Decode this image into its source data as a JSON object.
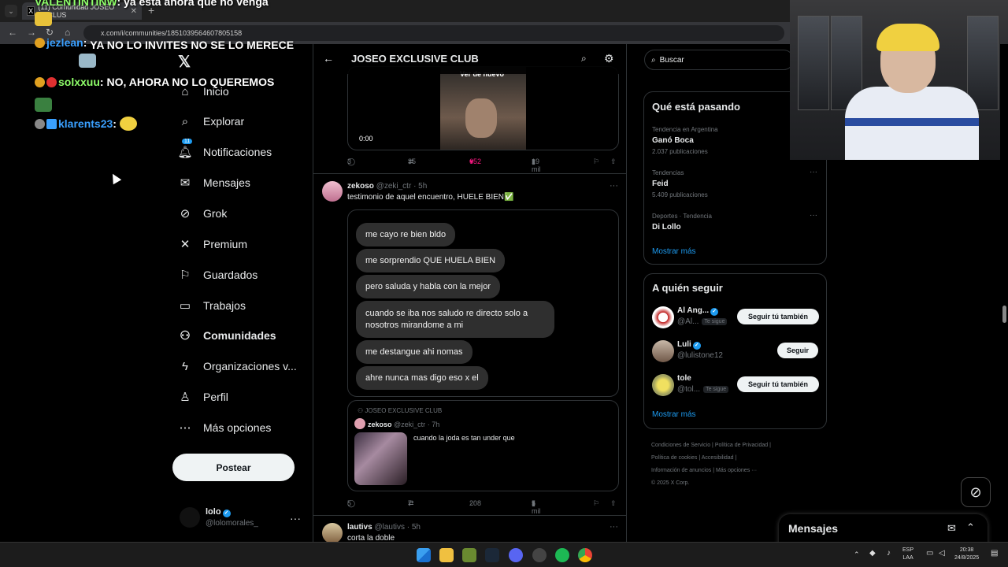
{
  "browser": {
    "tab_title": "(11) Comunidad JOSEO EXCLUS",
    "url": "x.com/i/communities/1851039564607805158"
  },
  "stream_chat": [
    {
      "user": "VALENTINTINW",
      "message": "ya está ahora que no venga",
      "user_color": "#8fff6a"
    },
    {
      "user": "jezlean",
      "message": "YA NO LO INVITES NO SE LO MERECE",
      "user_color": "#3aa0ff"
    },
    {
      "user": "solxxuu",
      "message": "NO, AHORA NO LO QUEREMOS",
      "user_color": "#8fff6a"
    },
    {
      "user": "klarents23",
      "message": "",
      "user_color": "#3aa0ff"
    }
  ],
  "sidebar": {
    "items": [
      {
        "label": "Inicio",
        "icon": "home-icon"
      },
      {
        "label": "Explorar",
        "icon": "search-icon"
      },
      {
        "label": "Notificaciones",
        "icon": "bell-icon",
        "badge": "11"
      },
      {
        "label": "Mensajes",
        "icon": "mail-icon"
      },
      {
        "label": "Grok",
        "icon": "grok-icon"
      },
      {
        "label": "Premium",
        "icon": "x-icon"
      },
      {
        "label": "Guardados",
        "icon": "bookmark-icon"
      },
      {
        "label": "Trabajos",
        "icon": "briefcase-icon"
      },
      {
        "label": "Comunidades",
        "icon": "people-icon",
        "active": true
      },
      {
        "label": "Organizaciones v...",
        "icon": "lightning-icon"
      },
      {
        "label": "Perfil",
        "icon": "person-icon"
      },
      {
        "label": "Más opciones",
        "icon": "more-icon"
      }
    ],
    "post_button": "Postear",
    "account": {
      "name": "lolo",
      "handle": "@lolomorales_"
    }
  },
  "main": {
    "title": "JOSEO EXCLUSIVE CLUB",
    "video_tweet": {
      "overlay_label": "Ver de nuevo",
      "time": "0:00",
      "replies": "3",
      "reposts": "35",
      "likes": "652",
      "views": "19 mil"
    },
    "tweet": {
      "name": "zekoso",
      "handle": "@zeki_ctr",
      "time": "· 5h",
      "text": "testimonio de aquel encuentro, HUELE BIEN✅",
      "chat_bubbles": [
        "me cayo re bien bldo",
        "me sorprendio QUE HUELA BIEN",
        "pero saluda y habla con la mejor",
        "cuando se iba nos saludo re directo solo a nosotros mirandome a mi",
        "me destangue ahi nomas",
        "ahre nunca mas digo eso x el"
      ],
      "quote": {
        "community": "JOSEO EXCLUSIVE CLUB",
        "name": "zekoso",
        "handle": "@zeki_ctr",
        "time": "· 7h",
        "text": "cuando la joda es tan under que"
      },
      "replies": "5",
      "reposts": "7",
      "likes": "208",
      "views": "5 mil"
    },
    "next_tweet": {
      "name": "lautivs",
      "handle": "@lautivs",
      "time": "· 5h",
      "text": "corta la doble"
    }
  },
  "right": {
    "search_placeholder": "Buscar",
    "trends_title": "Qué está pasando",
    "trends": [
      {
        "category": "Tendencia en Argentina",
        "name": "Ganó Boca",
        "count": "2.037 publicaciones"
      },
      {
        "category": "Tendencias",
        "name": "Feid",
        "count": "5.409 publicaciones"
      },
      {
        "category": "Deportes · Tendencia",
        "name": "Di Lollo",
        "count": ""
      }
    ],
    "show_more": "Mostrar más",
    "follow_title": "A quién seguir",
    "follow": [
      {
        "name": "Al Ang...",
        "handle": "@Al...",
        "follows_you": "Te sigue",
        "button": "Seguir tú también"
      },
      {
        "name": "Luli",
        "handle": "@lulistone12",
        "follows_you": "",
        "button": "Seguir"
      },
      {
        "name": "tole",
        "handle": "@tol...",
        "follows_you": "Te sigue",
        "button": "Seguir tú también"
      }
    ],
    "footer": [
      "Condiciones de Servicio",
      "Política de Privacidad",
      "Política de cookies",
      "Accesibilidad",
      "Información de anuncios",
      "Más opciones ···",
      "© 2025 X Corp."
    ]
  },
  "messages_drawer": {
    "title": "Mensajes"
  },
  "taskbar": {
    "lang": "ESP",
    "lang2": "LAA",
    "time": "20:38",
    "date": "24/8/2025"
  }
}
